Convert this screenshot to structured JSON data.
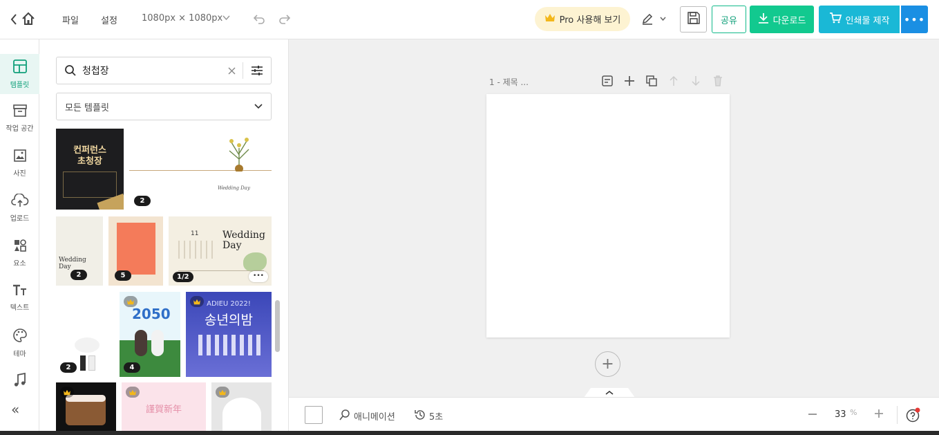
{
  "topbar": {
    "file_label": "파일",
    "settings_label": "설정",
    "size_label": "1080px × 1080px",
    "pro_label": "Pro 사용해 보기",
    "share_label": "공유",
    "download_label": "다운로드",
    "print_label": "인쇄물 제작",
    "more_label": "•••"
  },
  "rail": {
    "items": [
      {
        "label": "템플릿",
        "icon": "template-icon",
        "active": true
      },
      {
        "label": "작업 공간",
        "icon": "archive-icon"
      },
      {
        "label": "사진",
        "icon": "image-icon"
      },
      {
        "label": "업로드",
        "icon": "upload-cloud-icon"
      },
      {
        "label": "요소",
        "icon": "shapes-icon"
      },
      {
        "label": "텍스트",
        "icon": "text-icon"
      },
      {
        "label": "테마",
        "icon": "palette-icon"
      },
      {
        "label": "",
        "icon": "music-icon"
      }
    ],
    "collapse_label": "«"
  },
  "panel": {
    "search_value": "청첩장",
    "filter_value": "모든 템플릿",
    "templates": [
      {
        "title_line1": "컨퍼런스",
        "title_line2": "초청장",
        "badge": ""
      },
      {
        "title": "Wedding Day",
        "badge": "2"
      },
      {
        "title": "Wedding Day",
        "badge": "2"
      },
      {
        "title": "",
        "badge": "5"
      },
      {
        "title": "Wedding Day",
        "day": "11",
        "badge": "1/2"
      },
      {
        "title": "",
        "badge": "2"
      },
      {
        "title": "2050",
        "badge": "4",
        "pro": true
      },
      {
        "title": "송년의밤",
        "subtitle": "ADIEU 2022!",
        "pro": true
      },
      {
        "title": "",
        "pro": true
      },
      {
        "title": "謹賀新年",
        "pro": true
      },
      {
        "title": "",
        "pro": true
      }
    ]
  },
  "canvas": {
    "page_title": "1 - 제목 ...",
    "add_page_label": "+"
  },
  "bottombar": {
    "animation_label": "애니메이션",
    "duration_label": "5초",
    "zoom_value": "33",
    "zoom_unit": "%"
  },
  "colors": {
    "accent_green": "#12c98f",
    "accent_cyan": "#1ab8d6",
    "accent_blue": "#1a8fe3",
    "pro_bg": "#fdf3d2"
  }
}
